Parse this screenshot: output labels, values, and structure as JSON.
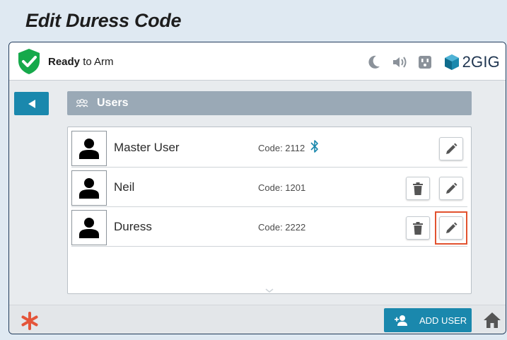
{
  "page": {
    "heading": "Edit Duress Code"
  },
  "status": {
    "state_bold": "Ready",
    "state_rest": " to Arm"
  },
  "status_icons": [
    "moon-icon",
    "speaker-icon",
    "outlet-icon"
  ],
  "brand": {
    "name": "2GIG",
    "color": "#1a88ad"
  },
  "section": {
    "title": "Users",
    "icon": "users-icon"
  },
  "users": [
    {
      "name": "Master User",
      "code": "Code: 2112",
      "bluetooth": true,
      "deletable": false
    },
    {
      "name": "Neil",
      "code": "Code: 1201",
      "bluetooth": false,
      "deletable": true
    },
    {
      "name": "Duress",
      "code": "Code: 2222",
      "bluetooth": false,
      "deletable": true,
      "highlighted_edit": true
    }
  ],
  "footer": {
    "add_user_label": "ADD USER"
  },
  "colors": {
    "accent": "#1a88ad",
    "highlight": "#e2522f",
    "shield": "#16a94b",
    "star": "#e4553a"
  }
}
